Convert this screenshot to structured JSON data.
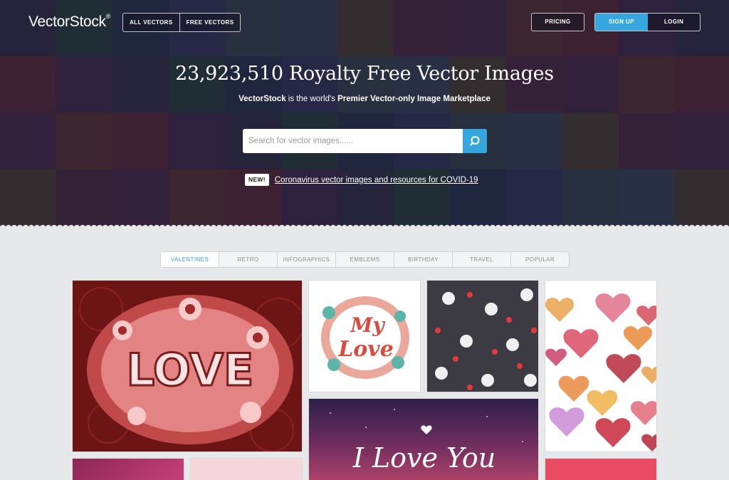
{
  "header": {
    "logo": "VectorStock",
    "logo_mark": "®",
    "switch": [
      "ALL VECTORS",
      "FREE VECTORS"
    ],
    "pricing": "PRICING",
    "signup": "SIGN UP",
    "login": "LOGIN"
  },
  "hero": {
    "headline": "23,923,510 Royalty Free Vector Images",
    "sub_brand": "VectorStock",
    "sub_mid": " is the world's ",
    "sub_strong": "Premier Vector-only Image Marketplace",
    "search_placeholder": "Search for vector images......",
    "news_badge": "NEW!",
    "news_link": "Coronavirus vector images and resources for COVID-19"
  },
  "tabs": [
    "VALENTINES",
    "RETRO",
    "INFOGRAPHICS",
    "EMBLEMS",
    "BIRTHDAY",
    "TRAVEL",
    "POPULAR"
  ],
  "gallery": {
    "love_word": "LOVE",
    "my_love_1": "My",
    "my_love_2": "Love",
    "i_love_you": "I Love You"
  },
  "colors": {
    "accent": "#36a6de",
    "hero_overlay": "#2b2a3c",
    "page_bg": "#e6e8ea"
  },
  "icons": [
    "search-icon"
  ]
}
